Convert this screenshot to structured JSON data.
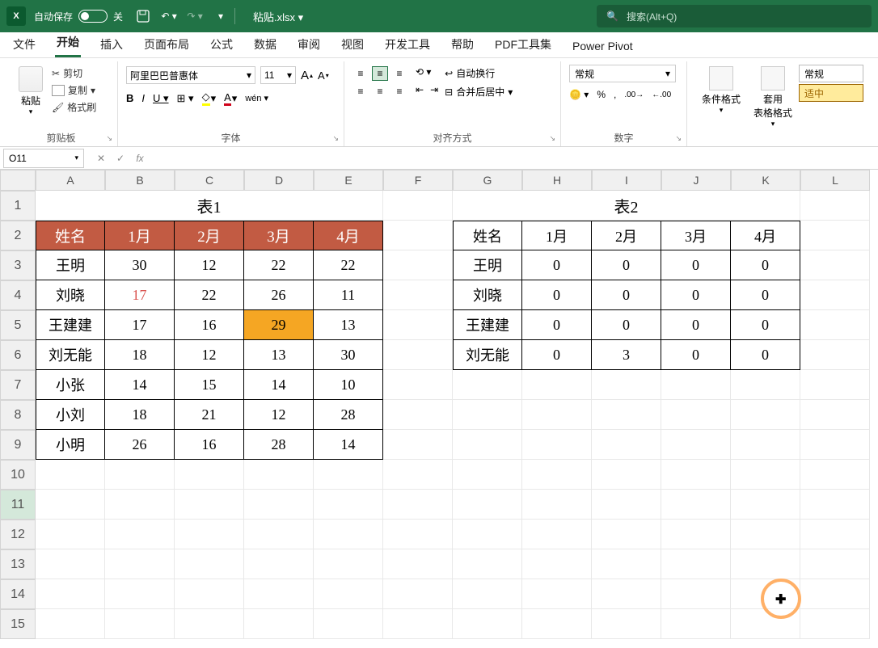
{
  "titlebar": {
    "autosave_label": "自动保存",
    "autosave_state": "关",
    "filename": "粘贴.xlsx",
    "search_placeholder": "搜索(Alt+Q)"
  },
  "tabs": {
    "file": "文件",
    "home": "开始",
    "insert": "插入",
    "layout": "页面布局",
    "formulas": "公式",
    "data": "数据",
    "review": "审阅",
    "view": "视图",
    "dev": "开发工具",
    "help": "帮助",
    "pdf": "PDF工具集",
    "pivot": "Power Pivot"
  },
  "ribbon": {
    "paste": "粘贴",
    "cut": "剪切",
    "copy": "复制",
    "format_painter": "格式刷",
    "clipboard_label": "剪贴板",
    "font_name": "阿里巴巴普惠体",
    "font_size": "11",
    "font_label": "字体",
    "wrap_text": "自动换行",
    "merge_center": "合并后居中",
    "align_label": "对齐方式",
    "number_format": "常规",
    "number_label": "数字",
    "cond_format": "条件格式",
    "table_format": "套用\n表格格式",
    "style_normal": "常规",
    "style_good": "适中"
  },
  "name_box": "O11",
  "columns": [
    "A",
    "B",
    "C",
    "D",
    "E",
    "F",
    "G",
    "H",
    "I",
    "J",
    "K",
    "L"
  ],
  "rows": [
    "1",
    "2",
    "3",
    "4",
    "5",
    "6",
    "7",
    "8",
    "9",
    "10",
    "11",
    "12",
    "13",
    "14",
    "15"
  ],
  "table1": {
    "title": "表1",
    "headers": [
      "姓名",
      "1月",
      "2月",
      "3月",
      "4月"
    ],
    "rows": [
      [
        "王明",
        "30",
        "12",
        "22",
        "22"
      ],
      [
        "刘晓",
        "17",
        "22",
        "26",
        "11"
      ],
      [
        "王建建",
        "17",
        "16",
        "29",
        "13"
      ],
      [
        "刘无能",
        "18",
        "12",
        "13",
        "30"
      ],
      [
        "小张",
        "14",
        "15",
        "14",
        "10"
      ],
      [
        "小刘",
        "18",
        "21",
        "12",
        "28"
      ],
      [
        "小明",
        "26",
        "16",
        "28",
        "14"
      ]
    ]
  },
  "table2": {
    "title": "表2",
    "headers": [
      "姓名",
      "1月",
      "2月",
      "3月",
      "4月"
    ],
    "rows": [
      [
        "王明",
        "0",
        "0",
        "0",
        "0"
      ],
      [
        "刘晓",
        "0",
        "0",
        "0",
        "0"
      ],
      [
        "王建建",
        "0",
        "0",
        "0",
        "0"
      ],
      [
        "刘无能",
        "0",
        "3",
        "0",
        "0"
      ]
    ]
  }
}
